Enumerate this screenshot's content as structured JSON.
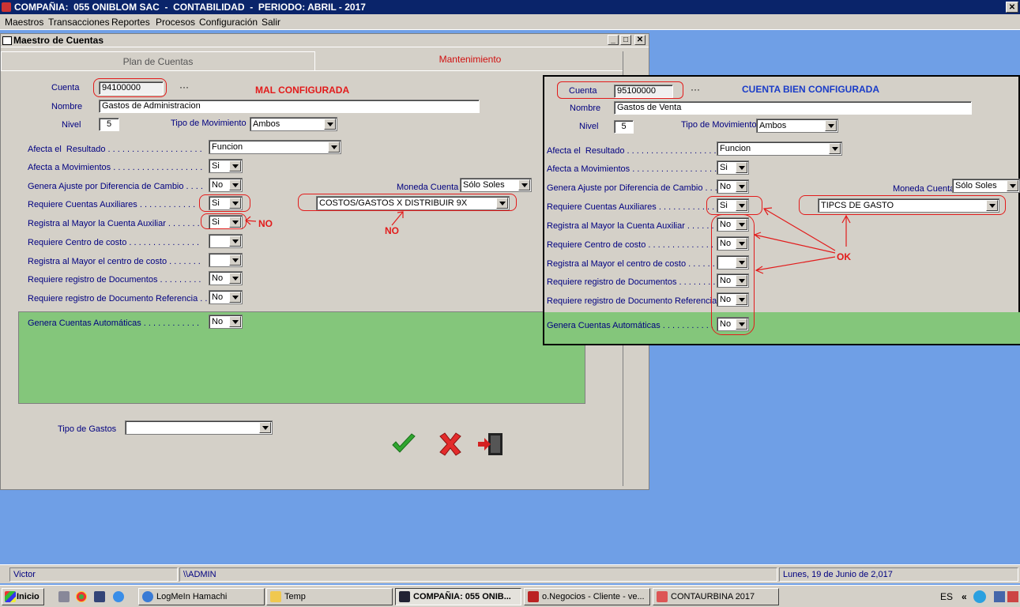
{
  "app_title": "COMPAÑIA:  055 ONIBLOM SAC  -  CONTABILIDAD  -  PERIODO: ABRIL - 2017",
  "menu": [
    "Maestros",
    "Transacciones",
    "Reportes",
    "Procesos",
    "Configuración",
    "Salir"
  ],
  "window": {
    "title": "Maestro de Cuentas",
    "tabs": [
      "Plan de Cuentas",
      "Mantenimiento"
    ],
    "annotation_title": "MAL CONFIGURADA",
    "annotation_no": "NO",
    "fields": {
      "cuenta_label": "Cuenta",
      "cuenta_value": "94100000",
      "cuenta_dots": "···",
      "nombre_label": "Nombre",
      "nombre_value": "Gastos de Administracion",
      "nivel_label": "Nivel",
      "nivel_value": "5",
      "tipo_mov_label": "Tipo de Movimiento",
      "tipo_mov_value": "Ambos",
      "afecta_res_label": "Afecta el  Resultado . . . . . . . . . . . . . . . . . . . .",
      "afecta_res_value": "Funcion",
      "afecta_mov_label": "Afecta a Movimientos . . . . . . . . . . . . . . . . . . .",
      "afecta_mov_value": "Si",
      "ajuste_label": "Genera Ajuste por Diferencia de Cambio . . . .",
      "ajuste_value": "No",
      "moneda_label": "Moneda Cuenta",
      "moneda_value": "Sólo Soles",
      "req_aux_label": "Requiere Cuentas Auxiliares . . . . . . . . . . . .",
      "req_aux_value": "Si",
      "aux_select_value": "COSTOS/GASTOS X DISTRIBUIR 9X",
      "reg_mayor_aux_label": "Registra al Mayor la Cuenta Auxiliar . . . . . . .",
      "reg_mayor_aux_value": "Si",
      "req_cc_label": "Requiere Centro de costo . . . . . . . . . . . . . . .",
      "req_cc_value": "",
      "reg_mayor_cc_label": "Registra al Mayor el centro de costo . . . . . . .",
      "reg_mayor_cc_value": "",
      "req_doc_label": "Requiere registro de Documentos . . . . . . . . .",
      "req_doc_value": "No",
      "req_docref_label": "Requiere registro de Documento Referencia . .",
      "req_docref_value": "No",
      "gen_auto_label": "Genera Cuentas Automáticas . . . . . . . . . . . .",
      "gen_auto_value": "No",
      "tipo_gastos_label": "Tipo de Gastos",
      "tipo_gastos_value": ""
    }
  },
  "overlay": {
    "annotation_title": "CUENTA BIEN CONFIGURADA",
    "annotation_ok": "OK",
    "cuenta_label": "Cuenta",
    "cuenta_value": "95100000",
    "cuenta_dots": "···",
    "nombre_label": "Nombre",
    "nombre_value": "Gastos de Venta",
    "nivel_label": "Nivel",
    "nivel_value": "5",
    "tipo_mov_label": "Tipo de Movimiento",
    "tipo_mov_value": "Ambos",
    "afecta_res_label": "Afecta el  Resultado . . . . . . . . . . . . . . . . . . . .",
    "afecta_res_value": "Funcion",
    "afecta_mov_label": "Afecta a Movimientos . . . . . . . . . . . . . . . . . . .",
    "afecta_mov_value": "Si",
    "ajuste_label": "Genera Ajuste por Diferencia de Cambio . . . .",
    "ajuste_value": "No",
    "moneda_label": "Moneda Cuenta",
    "moneda_value": "Sólo Soles",
    "req_aux_label": "Requiere Cuentas Auxiliares . . . . . . . . . . . .",
    "req_aux_value": "Si",
    "aux_select_value": "TIPCS DE GASTO",
    "reg_mayor_aux_label": "Registra al Mayor la Cuenta Auxiliar . . . . . . .",
    "reg_mayor_aux_value": "No",
    "req_cc_label": "Requiere Centro de costo . . . . . . . . . . . . . . .",
    "req_cc_value": "No",
    "reg_mayor_cc_label": "Registra al Mayor el centro de costo . . . . . . .",
    "reg_mayor_cc_value": "",
    "req_doc_label": "Requiere registro de Documentos . . . . . . . . .",
    "req_doc_value": "No",
    "req_docref_label": "Requiere registro de Documento Referencia . .",
    "req_docref_value": "No",
    "gen_auto_label": "Genera Cuentas Automáticas . . . . . . . . . . . .",
    "gen_auto_value": "No"
  },
  "statusbar": {
    "user": "Victor",
    "path": "\\\\ADMIN",
    "date": "Lunes, 19 de Junio de 2,017"
  },
  "taskbar": {
    "start": "Inicio",
    "buttons": [
      "LogMeIn Hamachi",
      "Temp",
      "COMPAÑIA:  055 ONIB...",
      "o.Negocios - Cliente - ve...",
      "CONTAURBINA 2017"
    ],
    "lang": "ES",
    "chevrons": "«"
  },
  "colors": {
    "title_bg": "#0a246a",
    "desktop": "#6f9fe6",
    "label_blue": "#000080",
    "annotation_red": "#e21b1b",
    "green_panel": "#84c67b"
  }
}
